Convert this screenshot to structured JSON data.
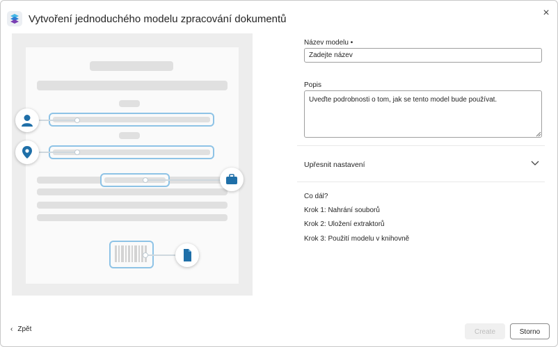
{
  "dialog": {
    "title": "Vytvoření jednoduchého modelu zpracování dokumentů",
    "close_symbol": "×"
  },
  "form": {
    "name_label": "Název modelu •",
    "name_value": "Zadejte název",
    "description_label": "Popis",
    "description_value": "Uveďte podrobnosti o tom, jak se tento model bude používat.",
    "advanced_label": "Upřesnit nastavení"
  },
  "next_steps": {
    "heading": "Co dál?",
    "steps": [
      "Krok 1: Nahrání souborů",
      "Krok 2: Uložení extraktorů",
      "Krok 3: Použití modelu v knihovně"
    ]
  },
  "footer": {
    "back_label": "Zpět",
    "back_symbol": "‹",
    "create_label": "Create",
    "cancel_label": "Storno"
  },
  "colors": {
    "accent_blue": "#1f6fa8",
    "highlight_border": "#8ec3e6",
    "disabled_text": "#bdbdbd"
  },
  "icons": {
    "app": "document-processing-icon",
    "close": "close-icon",
    "person": "person-icon",
    "location": "location-pin-icon",
    "briefcase": "briefcase-icon",
    "barcode": "barcode-icon",
    "document": "document-icon",
    "chevron": "chevron-down-icon",
    "back": "chevron-left-icon"
  }
}
